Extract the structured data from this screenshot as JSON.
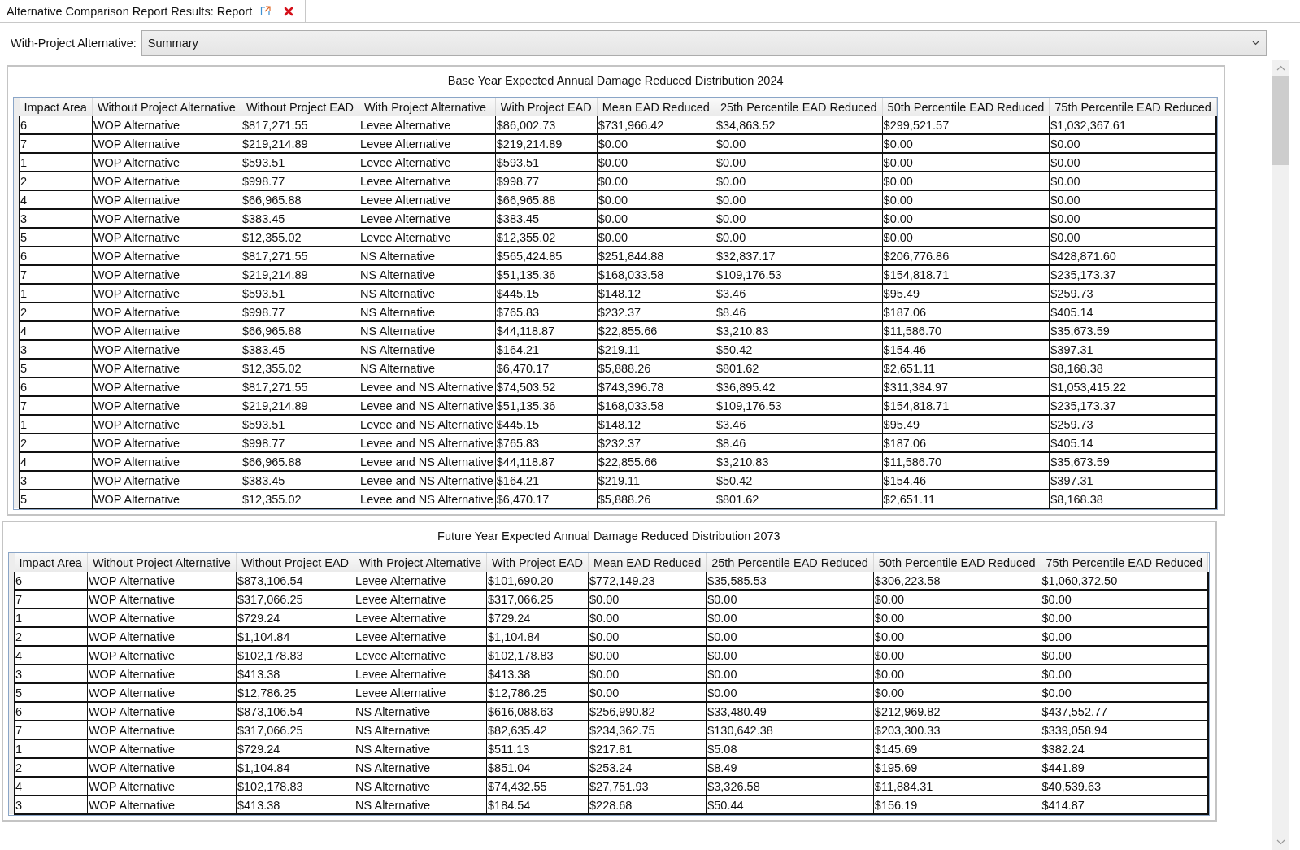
{
  "tab": {
    "title": "Alternative Comparison Report Results: Report",
    "selected": true
  },
  "selector": {
    "label": "With-Project Alternative:",
    "value": "Summary"
  },
  "tables": [
    {
      "title": "Base Year Expected Annual Damage Reduced Distribution 2024",
      "columns": [
        "Impact Area",
        "Without Project Alternative",
        "Without Project EAD",
        "With Project Alternative",
        "With Project EAD",
        "Mean EAD Reduced",
        "25th Percentile EAD Reduced",
        "50th Percentile EAD Reduced",
        "75th Percentile EAD Reduced"
      ],
      "rows": [
        [
          "6",
          "WOP Alternative",
          "$817,271.55",
          "Levee Alternative",
          "$86,002.73",
          "$731,966.42",
          "$34,863.52",
          "$299,521.57",
          "$1,032,367.61"
        ],
        [
          "7",
          "WOP Alternative",
          "$219,214.89",
          "Levee Alternative",
          "$219,214.89",
          "$0.00",
          "$0.00",
          "$0.00",
          "$0.00"
        ],
        [
          "1",
          "WOP Alternative",
          "$593.51",
          "Levee Alternative",
          "$593.51",
          "$0.00",
          "$0.00",
          "$0.00",
          "$0.00"
        ],
        [
          "2",
          "WOP Alternative",
          "$998.77",
          "Levee Alternative",
          "$998.77",
          "$0.00",
          "$0.00",
          "$0.00",
          "$0.00"
        ],
        [
          "4",
          "WOP Alternative",
          "$66,965.88",
          "Levee Alternative",
          "$66,965.88",
          "$0.00",
          "$0.00",
          "$0.00",
          "$0.00"
        ],
        [
          "3",
          "WOP Alternative",
          "$383.45",
          "Levee Alternative",
          "$383.45",
          "$0.00",
          "$0.00",
          "$0.00",
          "$0.00"
        ],
        [
          "5",
          "WOP Alternative",
          "$12,355.02",
          "Levee Alternative",
          "$12,355.02",
          "$0.00",
          "$0.00",
          "$0.00",
          "$0.00"
        ],
        [
          "6",
          "WOP Alternative",
          "$817,271.55",
          "NS Alternative",
          "$565,424.85",
          "$251,844.88",
          "$32,837.17",
          "$206,776.86",
          "$428,871.60"
        ],
        [
          "7",
          "WOP Alternative",
          "$219,214.89",
          "NS Alternative",
          "$51,135.36",
          "$168,033.58",
          "$109,176.53",
          "$154,818.71",
          "$235,173.37"
        ],
        [
          "1",
          "WOP Alternative",
          "$593.51",
          "NS Alternative",
          "$445.15",
          "$148.12",
          "$3.46",
          "$95.49",
          "$259.73"
        ],
        [
          "2",
          "WOP Alternative",
          "$998.77",
          "NS Alternative",
          "$765.83",
          "$232.37",
          "$8.46",
          "$187.06",
          "$405.14"
        ],
        [
          "4",
          "WOP Alternative",
          "$66,965.88",
          "NS Alternative",
          "$44,118.87",
          "$22,855.66",
          "$3,210.83",
          "$11,586.70",
          "$35,673.59"
        ],
        [
          "3",
          "WOP Alternative",
          "$383.45",
          "NS Alternative",
          "$164.21",
          "$219.11",
          "$50.42",
          "$154.46",
          "$397.31"
        ],
        [
          "5",
          "WOP Alternative",
          "$12,355.02",
          "NS Alternative",
          "$6,470.17",
          "$5,888.26",
          "$801.62",
          "$2,651.11",
          "$8,168.38"
        ],
        [
          "6",
          "WOP Alternative",
          "$817,271.55",
          "Levee and NS Alternative",
          "$74,503.52",
          "$743,396.78",
          "$36,895.42",
          "$311,384.97",
          "$1,053,415.22"
        ],
        [
          "7",
          "WOP Alternative",
          "$219,214.89",
          "Levee and NS Alternative",
          "$51,135.36",
          "$168,033.58",
          "$109,176.53",
          "$154,818.71",
          "$235,173.37"
        ],
        [
          "1",
          "WOP Alternative",
          "$593.51",
          "Levee and NS Alternative",
          "$445.15",
          "$148.12",
          "$3.46",
          "$95.49",
          "$259.73"
        ],
        [
          "2",
          "WOP Alternative",
          "$998.77",
          "Levee and NS Alternative",
          "$765.83",
          "$232.37",
          "$8.46",
          "$187.06",
          "$405.14"
        ],
        [
          "4",
          "WOP Alternative",
          "$66,965.88",
          "Levee and NS Alternative",
          "$44,118.87",
          "$22,855.66",
          "$3,210.83",
          "$11,586.70",
          "$35,673.59"
        ],
        [
          "3",
          "WOP Alternative",
          "$383.45",
          "Levee and NS Alternative",
          "$164.21",
          "$219.11",
          "$50.42",
          "$154.46",
          "$397.31"
        ],
        [
          "5",
          "WOP Alternative",
          "$12,355.02",
          "Levee and NS Alternative",
          "$6,470.17",
          "$5,888.26",
          "$801.62",
          "$2,651.11",
          "$8,168.38"
        ]
      ]
    },
    {
      "title": "Future Year Expected Annual Damage Reduced Distribution 2073",
      "columns": [
        "Impact Area",
        "Without Project Alternative",
        "Without Project EAD",
        "With Project Alternative",
        "With Project EAD",
        "Mean EAD Reduced",
        "25th Percentile EAD Reduced",
        "50th Percentile EAD Reduced",
        "75th Percentile EAD Reduced"
      ],
      "rows": [
        [
          "6",
          "WOP Alternative",
          "$873,106.54",
          "Levee Alternative",
          "$101,690.20",
          "$772,149.23",
          "$35,585.53",
          "$306,223.58",
          "$1,060,372.50"
        ],
        [
          "7",
          "WOP Alternative",
          "$317,066.25",
          "Levee Alternative",
          "$317,066.25",
          "$0.00",
          "$0.00",
          "$0.00",
          "$0.00"
        ],
        [
          "1",
          "WOP Alternative",
          "$729.24",
          "Levee Alternative",
          "$729.24",
          "$0.00",
          "$0.00",
          "$0.00",
          "$0.00"
        ],
        [
          "2",
          "WOP Alternative",
          "$1,104.84",
          "Levee Alternative",
          "$1,104.84",
          "$0.00",
          "$0.00",
          "$0.00",
          "$0.00"
        ],
        [
          "4",
          "WOP Alternative",
          "$102,178.83",
          "Levee Alternative",
          "$102,178.83",
          "$0.00",
          "$0.00",
          "$0.00",
          "$0.00"
        ],
        [
          "3",
          "WOP Alternative",
          "$413.38",
          "Levee Alternative",
          "$413.38",
          "$0.00",
          "$0.00",
          "$0.00",
          "$0.00"
        ],
        [
          "5",
          "WOP Alternative",
          "$12,786.25",
          "Levee Alternative",
          "$12,786.25",
          "$0.00",
          "$0.00",
          "$0.00",
          "$0.00"
        ],
        [
          "6",
          "WOP Alternative",
          "$873,106.54",
          "NS Alternative",
          "$616,088.63",
          "$256,990.82",
          "$33,480.49",
          "$212,969.82",
          "$437,552.77"
        ],
        [
          "7",
          "WOP Alternative",
          "$317,066.25",
          "NS Alternative",
          "$82,635.42",
          "$234,362.75",
          "$130,642.38",
          "$203,300.33",
          "$339,058.94"
        ],
        [
          "1",
          "WOP Alternative",
          "$729.24",
          "NS Alternative",
          "$511.13",
          "$217.81",
          "$5.08",
          "$145.69",
          "$382.24"
        ],
        [
          "2",
          "WOP Alternative",
          "$1,104.84",
          "NS Alternative",
          "$851.04",
          "$253.24",
          "$8.49",
          "$195.69",
          "$441.89"
        ],
        [
          "4",
          "WOP Alternative",
          "$102,178.83",
          "NS Alternative",
          "$74,432.55",
          "$27,751.93",
          "$3,326.58",
          "$11,884.31",
          "$40,539.63"
        ],
        [
          "3",
          "WOP Alternative",
          "$413.38",
          "NS Alternative",
          "$184.54",
          "$228.68",
          "$50.44",
          "$156.19",
          "$414.87"
        ]
      ]
    }
  ]
}
